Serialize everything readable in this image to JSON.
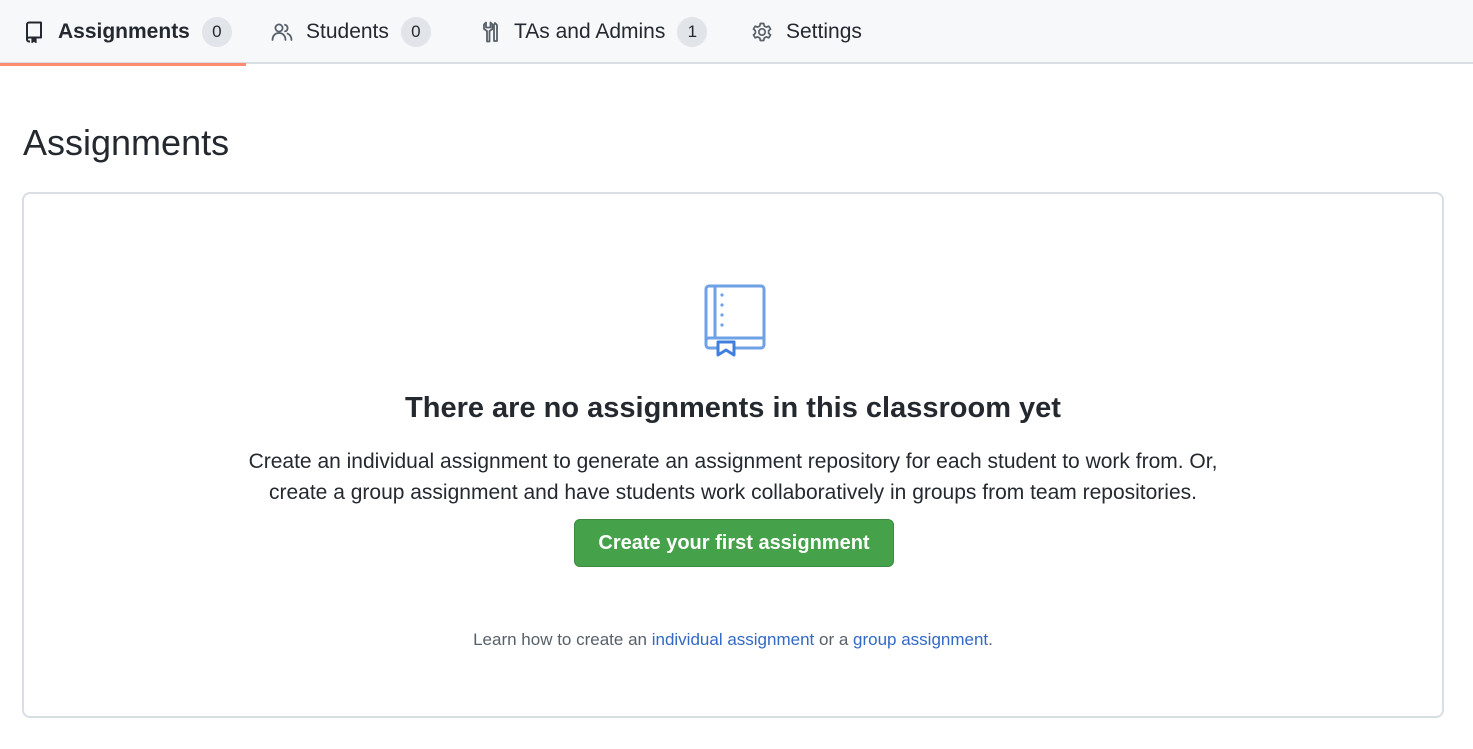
{
  "tabs": [
    {
      "label": "Assignments",
      "count": "0",
      "icon": "repo-icon",
      "active": true
    },
    {
      "label": "Students",
      "count": "0",
      "icon": "people-icon",
      "active": false
    },
    {
      "label": "TAs and Admins",
      "count": "1",
      "icon": "tools-icon",
      "active": false
    },
    {
      "label": "Settings",
      "count": "",
      "icon": "gear-icon",
      "active": false
    }
  ],
  "page": {
    "title": "Assignments"
  },
  "empty_state": {
    "icon": "book-icon",
    "title": "There are no assignments in this classroom yet",
    "description_line1": "Create an individual assignment to generate an assignment repository for each student to work from. Or,",
    "description_line2": "create a group assignment and have students work collaboratively in groups from team repositories.",
    "button_label": "Create your first assignment",
    "learn_prefix": "Learn how to create an ",
    "learn_link1": "individual assignment",
    "learn_middle": " or a ",
    "learn_link2": "group assignment",
    "learn_suffix": "."
  },
  "colors": {
    "accent_underline": "#fd8c73",
    "primary_button": "#46a14b",
    "link": "#3169c4",
    "icon_blue": "#6ea1e6"
  }
}
